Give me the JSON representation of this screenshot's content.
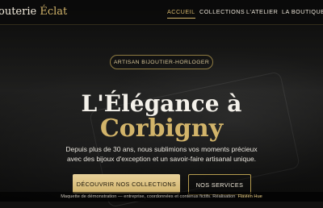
{
  "header": {
    "brand": {
      "text_main": "outerie ",
      "text_accent": "Éclat"
    },
    "nav": [
      {
        "label": "ACCUEIL",
        "active": true
      },
      {
        "label": "COLLECTIONS",
        "active": false
      },
      {
        "label": "L'ATELIER",
        "active": false
      },
      {
        "label": "LA BOUTIQUE",
        "active": false
      }
    ]
  },
  "hero": {
    "badge": "ARTISAN BIJOUTIER-HORLOGER",
    "title_line1": "L'Élégance à",
    "title_line2": "Corbigny",
    "subtitle_line1": "Depuis plus de 30 ans, nous sublimions vos moments précieux",
    "subtitle_line2": "avec des bijoux d'exception et un savoir-faire artisanal unique.",
    "buttons": {
      "primary": "DÉCOUVRIR NOS COLLECTIONS",
      "secondary": "NOS SERVICES"
    }
  },
  "footer": {
    "note": "Maquette de démonstration — entreprise, coordonnées et contenus fictifs. Réalisation",
    "author": "Flavien Hue"
  },
  "colors": {
    "accent_gold": "#d2b46a",
    "background": "#121110",
    "text_primary": "#f4f1ea"
  }
}
